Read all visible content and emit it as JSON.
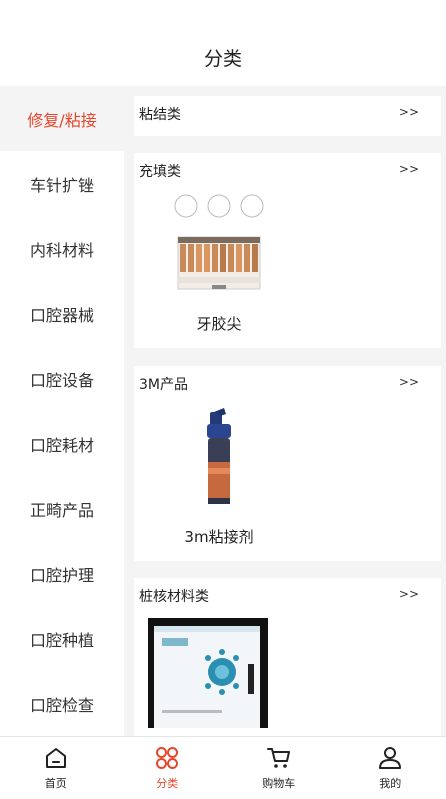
{
  "header": {
    "title": "分类"
  },
  "sidebar": {
    "items": [
      {
        "label": "修复/粘接",
        "active": true
      },
      {
        "label": "车针扩锉"
      },
      {
        "label": "内科材料"
      },
      {
        "label": "口腔器械"
      },
      {
        "label": "口腔设备"
      },
      {
        "label": "口腔耗材"
      },
      {
        "label": "正畸产品"
      },
      {
        "label": "口腔护理"
      },
      {
        "label": "口腔种植"
      },
      {
        "label": "口腔检查"
      }
    ]
  },
  "sections": [
    {
      "title": "粘结类",
      "more": ">>"
    },
    {
      "title": "充填类",
      "more": ">>",
      "product": {
        "label": "牙胶尖",
        "image": "gutta-percha-box"
      }
    },
    {
      "title": "3M产品",
      "more": ">>",
      "product": {
        "label": "3m粘接剂",
        "image": "adhesive-bottle"
      }
    },
    {
      "title": "桩核材料类",
      "more": ">>",
      "product": {
        "image": "post-core-box"
      }
    }
  ],
  "tabbar": {
    "tabs": [
      {
        "label": "首页",
        "icon": "home-icon"
      },
      {
        "label": "分类",
        "icon": "category-icon",
        "active": true
      },
      {
        "label": "购物车",
        "icon": "cart-icon"
      },
      {
        "label": "我的",
        "icon": "user-icon"
      }
    ]
  },
  "colors": {
    "accent": "#e8452c",
    "background": "#f4f4f4"
  }
}
